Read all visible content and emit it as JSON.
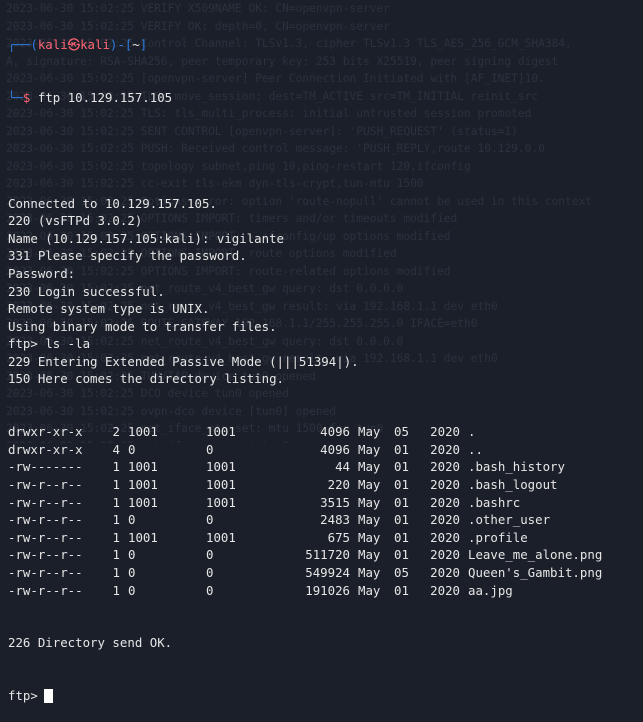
{
  "background_lines": [
    "2023-06-30 15:02:25 VERIFY X509NAME OK: CN=openvpn-server",
    "2023-06-30 15:02:25 VERIFY OK: depth=0, CN=openvpn-server",
    "2023-06-30 15:02:25 Control Channel: TLSv1.3, cipher TLSv1.3 TLS_AES_256_GCM_SHA384,",
    "A, signature: RSA-SHA256, peer temporary key: 253 bits X25519, peer signing digest",
    "2023-06-30 15:02:25 [openvpn-server] Peer Connection Initiated with [AF_INET]10.",
    "2023-06-30 15:02:25 TLS: move_session: dest=TM_ACTIVE src=TM_INITIAL reinit_src",
    "2023-06-30 15:02:25 TLS: tls_multi_process: initial untrusted session promoted",
    "2023-06-30 15:02:25 SENT CONTROL [openvpn-server]: 'PUSH_REQUEST' (status=1)",
    "2023-06-30 15:02:25 PUSH: Received control message: 'PUSH_REPLY,route 10.129.0.0",
    "2023-06-30 15:02:25 topology subnet,ping 10,ping-restart 120,ifconfig",
    "2023-06-30 15:02:25 cc-exit tls-ekm dyn-tls-crypt,tun-mtu 1500",
    "2023-06-30 15:02:25 Options error: option 'route-nopull' cannot be used in this context",
    "2023-06-30 15:02:25 OPTIONS IMPORT: timers and/or timeouts modified",
    "2023-06-30 15:02:25 OPTIONS IMPORT: --ifconfig/up options modified",
    "2023-06-30 15:02:25 OPTIONS IMPORT: route options modified",
    "2023-06-30 15:02:25 OPTIONS IMPORT: route-related options modified",
    "2023-06-30 15:02:25 net_route_v4_best_gw query: dst 0.0.0.0",
    "2023-06-30 15:02:25 net_route_v4_best_gw result: via 192.168.1.1 dev eth0",
    "2023-06-30 15:02:25 ROUTE_GATEWAY 192.168.1.1/255.255.255.0 IFACE=eth0",
    "2023-06-30 15:02:25 net_route_v4_best_gw query: dst 0.0.0.0",
    "2023-06-30 15:02:25 net_route_v4_best_gw result: via 192.168.1.1 dev eth0",
    "2023-06-30 15:02:25 TUN/TAP device tun0 opened",
    "2023-06-30 15:02:25 DCO device tun0 opened",
    "2023-06-30 15:02:25 ovpn-dco device [tun0] opened",
    "2023-06-30 15:02:25 net_iface_mtu_set: mtu 1500 for tun0",
    "2023-06-30 15:02:25 net_iface_up: set tun0 up",
    "2023-06-30 15:02:25 net_addr_v4_add: 10.10.14.18/23 dev tun0"
  ],
  "prompt": {
    "corner_top": "┌──(",
    "user": "kali",
    "at": "㉿",
    "host": "kali",
    "mid": ")-[",
    "path": "~",
    "end": "]",
    "corner_bottom": "└─",
    "dollar": "$",
    "command": "ftp 10.129.157.105"
  },
  "output_lines": [
    "Connected to 10.129.157.105.",
    "220 (vsFTPd 3.0.2)",
    "Name (10.129.157.105:kali): vigilante",
    "331 Please specify the password.",
    "Password:",
    "230 Login successful.",
    "Remote system type is UNIX.",
    "Using binary mode to transfer files.",
    "ftp> ls -la",
    "229 Entering Extended Passive Mode (|||51394|).",
    "150 Here comes the directory listing."
  ],
  "listing": [
    {
      "perm": "drwxr-xr-x",
      "links": "2",
      "uid": "1001",
      "gid": "1001",
      "size": "4096",
      "month": "May",
      "day": "05",
      "year": "2020",
      "name": "."
    },
    {
      "perm": "drwxr-xr-x",
      "links": "4",
      "uid": "0",
      "gid": "0",
      "size": "4096",
      "month": "May",
      "day": "01",
      "year": "2020",
      "name": ".."
    },
    {
      "perm": "-rw-------",
      "links": "1",
      "uid": "1001",
      "gid": "1001",
      "size": "44",
      "month": "May",
      "day": "01",
      "year": "2020",
      "name": ".bash_history"
    },
    {
      "perm": "-rw-r--r--",
      "links": "1",
      "uid": "1001",
      "gid": "1001",
      "size": "220",
      "month": "May",
      "day": "01",
      "year": "2020",
      "name": ".bash_logout"
    },
    {
      "perm": "-rw-r--r--",
      "links": "1",
      "uid": "1001",
      "gid": "1001",
      "size": "3515",
      "month": "May",
      "day": "01",
      "year": "2020",
      "name": ".bashrc"
    },
    {
      "perm": "-rw-r--r--",
      "links": "1",
      "uid": "0",
      "gid": "0",
      "size": "2483",
      "month": "May",
      "day": "01",
      "year": "2020",
      "name": ".other_user"
    },
    {
      "perm": "-rw-r--r--",
      "links": "1",
      "uid": "1001",
      "gid": "1001",
      "size": "675",
      "month": "May",
      "day": "01",
      "year": "2020",
      "name": ".profile"
    },
    {
      "perm": "-rw-r--r--",
      "links": "1",
      "uid": "0",
      "gid": "0",
      "size": "511720",
      "month": "May",
      "day": "01",
      "year": "2020",
      "name": "Leave_me_alone.png"
    },
    {
      "perm": "-rw-r--r--",
      "links": "1",
      "uid": "0",
      "gid": "0",
      "size": "549924",
      "month": "May",
      "day": "05",
      "year": "2020",
      "name": "Queen's_Gambit.png"
    },
    {
      "perm": "-rw-r--r--",
      "links": "1",
      "uid": "0",
      "gid": "0",
      "size": "191026",
      "month": "May",
      "day": "01",
      "year": "2020",
      "name": "aa.jpg"
    }
  ],
  "final_lines": [
    "226 Directory send OK."
  ],
  "final_prompt": "ftp>",
  "colors": {
    "background": "#1b1f29",
    "prompt_blue": "#2f7ee0",
    "prompt_red": "#ff6473",
    "text": "#e6e6e6"
  }
}
